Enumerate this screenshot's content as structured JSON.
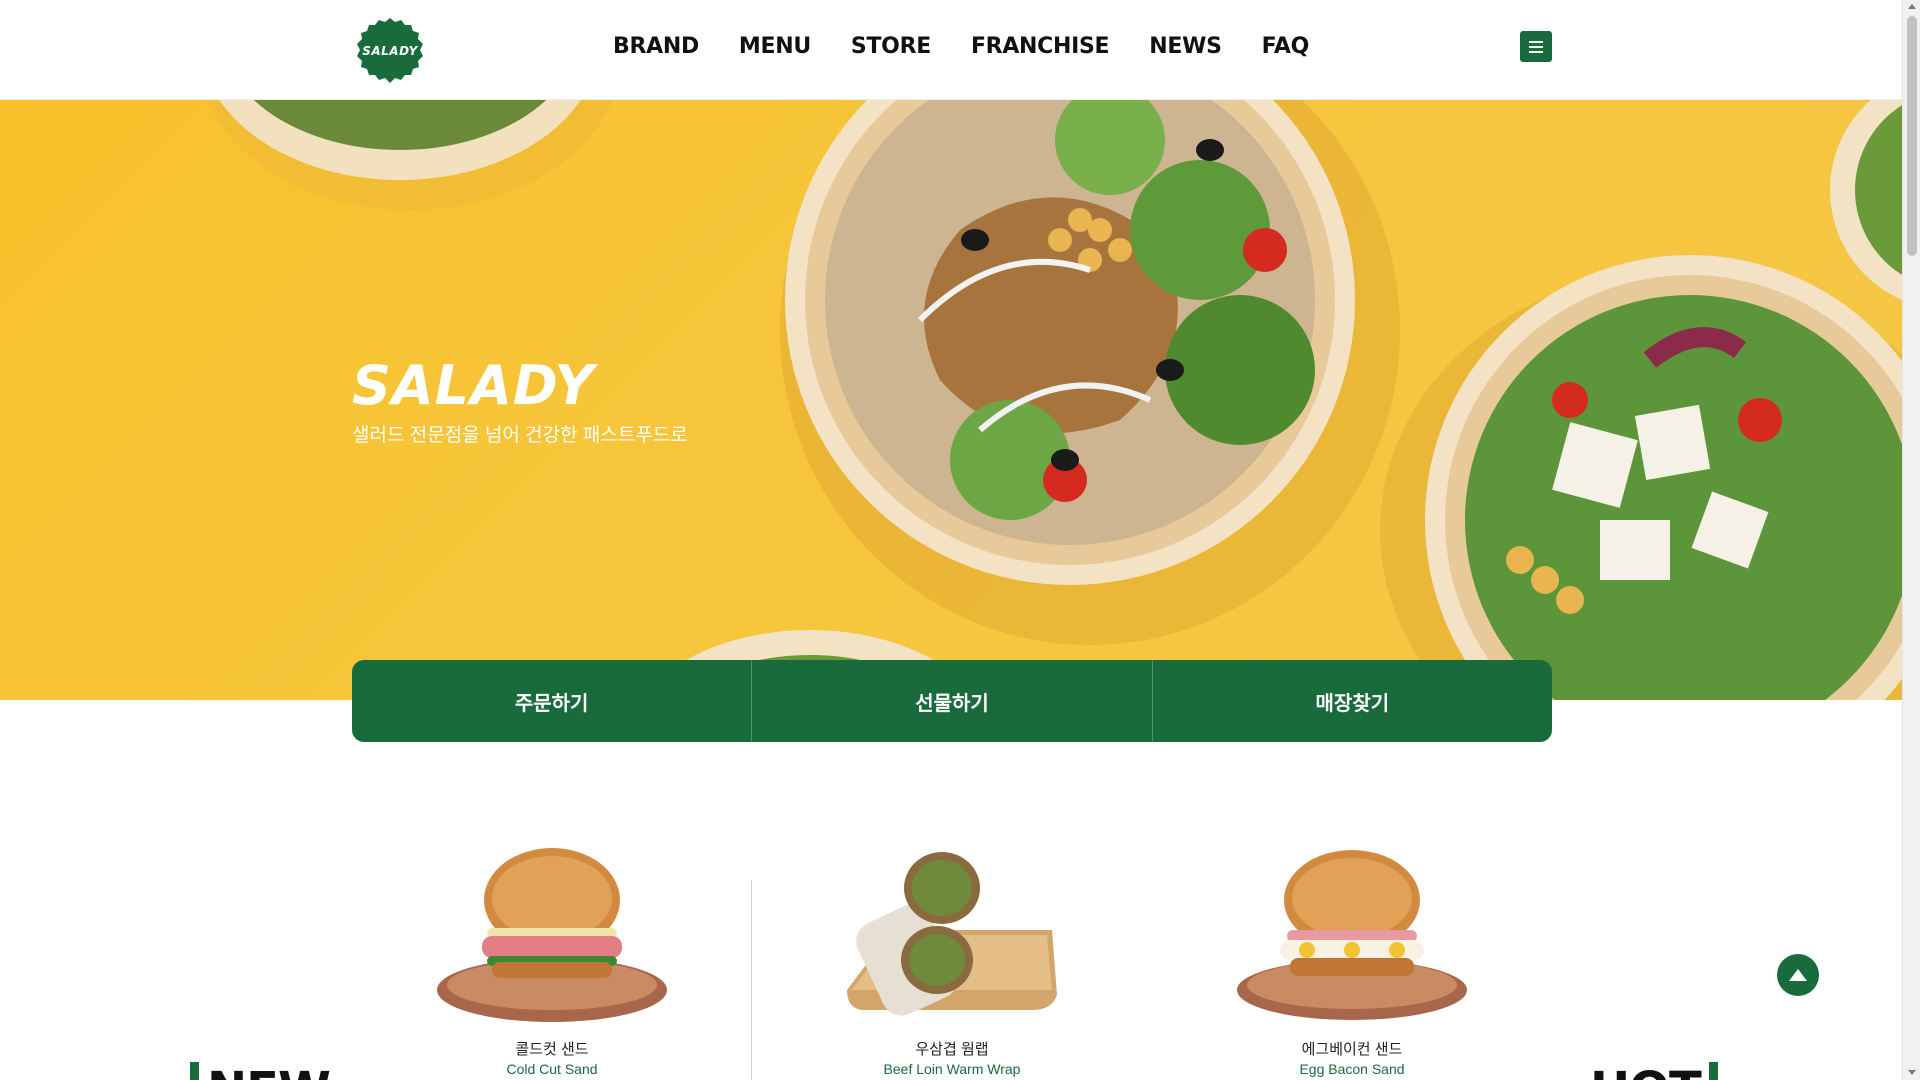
{
  "header": {
    "logo_text": "SALADY",
    "nav": [
      "BRAND",
      "MENU",
      "STORE",
      "FRANCHISE",
      "NEWS",
      "FAQ"
    ]
  },
  "hero": {
    "title": "SALADY",
    "subtitle": "샐러드 전문점을 넘어 건강한 패스트푸드로"
  },
  "quick_links": [
    "주문하기",
    "선물하기",
    "매장찾기"
  ],
  "products": [
    {
      "name_ko": "콜드컷 샌드",
      "name_en": "Cold Cut Sand"
    },
    {
      "name_ko": "우삼겹 웜랩",
      "name_en": "Beef Loin Warm Wrap"
    },
    {
      "name_ko": "에그베이컨 샌드",
      "name_en": "Egg Bacon Sand"
    }
  ],
  "section_labels": {
    "new": "NEW",
    "hot": "HOT"
  },
  "colors": {
    "brand_green": "#1a6b3c",
    "hero_yellow": "#f7c22a"
  },
  "icons": {
    "menu": "hamburger-menu-icon",
    "top": "arrow-up-icon"
  }
}
